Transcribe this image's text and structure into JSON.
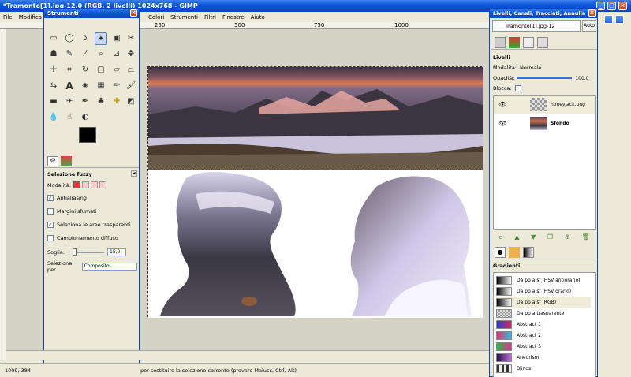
{
  "window": {
    "title": "*Tramonto[1].jpg-12.0 (RGB, 2 livelli) 1024x768 - GIMP"
  },
  "menu": [
    "File",
    "Modifica",
    "Colori",
    "Strumenti",
    "Filtri",
    "Finestre",
    "Aiuto"
  ],
  "ruler": [
    "250",
    "500",
    "750",
    "1000"
  ],
  "toolbox": {
    "title": "Strumenti",
    "options": {
      "title": "Selezione fuzzy",
      "mode_label": "Modalità:",
      "antialiasing": "Antialiasing",
      "feather": "Margini sfumati",
      "select_transparent": "Seleziona le aree trasparenti",
      "sample_merged": "Campionamento diffuso",
      "threshold_label": "Soglia:",
      "threshold_value": "15,0",
      "select_by_label": "Seleziona per",
      "select_by_value": "Composito"
    }
  },
  "status": {
    "coords": "1009, 384",
    "message": "per sostituire la selezione corrente (provare Maiusc, Ctrl, Alt)"
  },
  "dock": {
    "title": "Livelli, Canali, Tracciati, Annulla - ...",
    "image_select": "Tramonto[1].jpg-12",
    "auto": "Auto",
    "layers": {
      "title": "Livelli",
      "mode_label": "Modalità:",
      "mode_value": "Normale",
      "opacity_label": "Opacità:",
      "opacity_value": "100,0",
      "lock_label": "Blocca:",
      "items": [
        {
          "name": "honeyjack.png"
        },
        {
          "name": "Sfondo"
        }
      ]
    },
    "gradients": {
      "title": "Gradienti",
      "items": [
        {
          "name": "Da pp a sf (HSV antiorario)",
          "c1": "#000000",
          "c2": "#ffffff"
        },
        {
          "name": "Da pp a sf (HSV orario)",
          "c1": "#000000",
          "c2": "#ffffff"
        },
        {
          "name": "Da pp a sf (RGB)",
          "c1": "#000000",
          "c2": "#ffffff"
        },
        {
          "name": "Da pp a trasparente",
          "c1": "#000000",
          "c2": "#cccccc"
        },
        {
          "name": "Abstract 1",
          "c1": "#2a3cd8",
          "c2": "#d82a5a"
        },
        {
          "name": "Abstract 2",
          "c1": "#e0306a",
          "c2": "#30c0e0"
        },
        {
          "name": "Abstract 3",
          "c1": "#28b848",
          "c2": "#e83090"
        },
        {
          "name": "Aneurism",
          "c1": "#201040",
          "c2": "#c070e0"
        },
        {
          "name": "Blinds",
          "c1": "#333333",
          "c2": "#eeeeee"
        }
      ]
    }
  }
}
